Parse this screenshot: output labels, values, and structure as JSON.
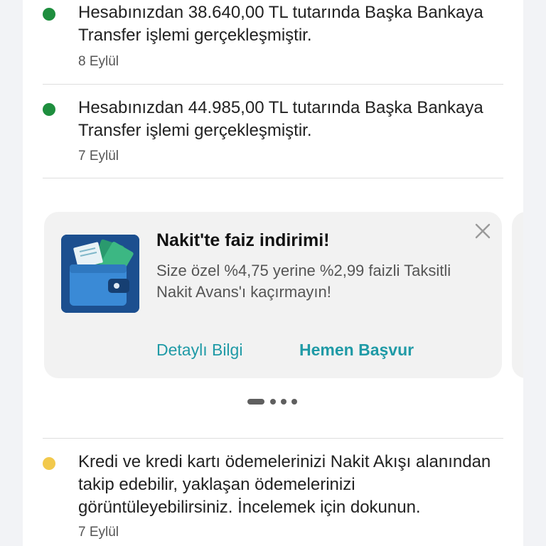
{
  "colors": {
    "success_dot": "#1e8e3e",
    "info_dot": "#f2c94c",
    "accent": "#1f9aa6"
  },
  "notifications": [
    {
      "status": "success",
      "message": "Hesabınızdan 38.640,00 TL tutarında Başka Bankaya Transfer işlemi gerçekleşmiştir.",
      "date": "8 Eylül"
    },
    {
      "status": "success",
      "message": "Hesabınızdan 44.985,00 TL tutarında Başka Bankaya Transfer işlemi gerçekleşmiştir.",
      "date": "7 Eylül"
    },
    {
      "status": "info",
      "message": "Kredi ve kredi kartı ödemelerinizi Nakit Akışı alanından takip edebilir, yaklaşan ödemelerinizi görüntüleyebilirsiniz. İncelemek için dokunun.",
      "date": "7 Eylül"
    }
  ],
  "promo_card": {
    "icon": "wallet-cash-icon",
    "title": "Nakit'te faiz indirimi!",
    "description": "Size özel %4,75 yerine %2,99 faizli Taksitli Nakit Avans'ı kaçırmayın!",
    "close_icon": "close-icon",
    "secondary_action": "Detaylı Bilgi",
    "primary_action": "Hemen Başvur"
  },
  "carousel": {
    "page_count": 4,
    "active_index": 0
  }
}
